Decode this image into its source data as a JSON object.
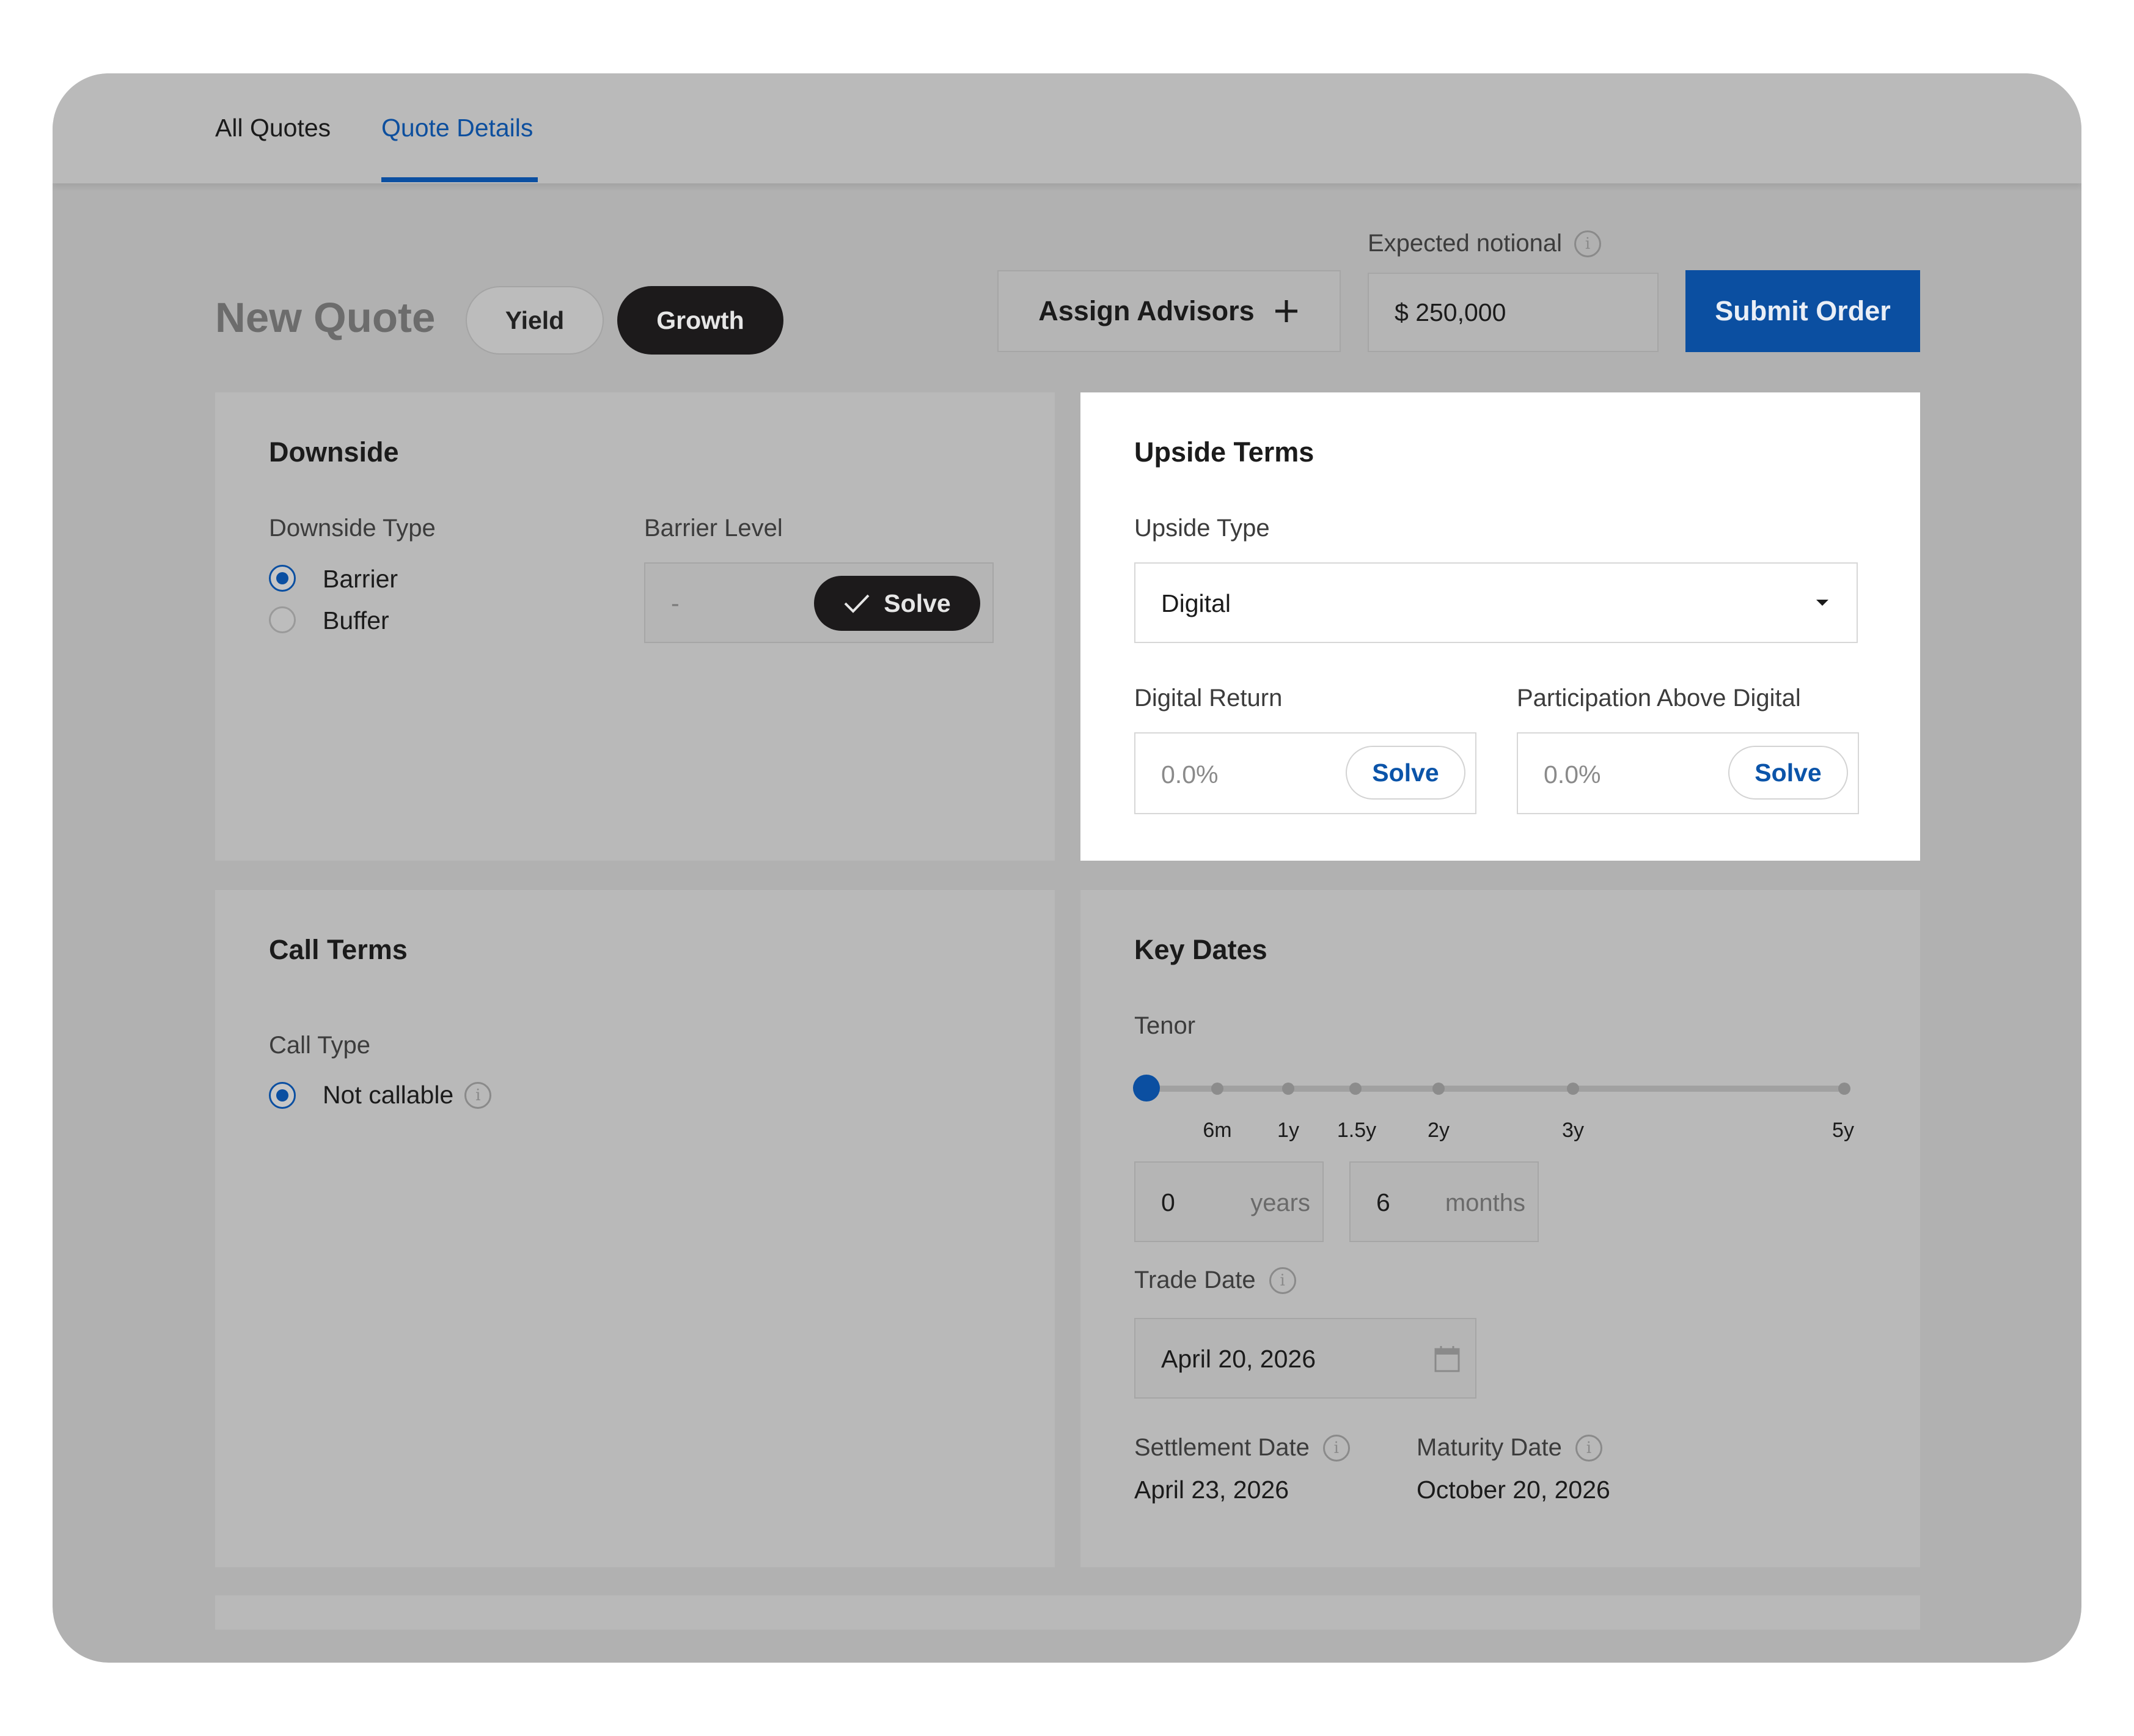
{
  "tabs": [
    {
      "label": "All Quotes"
    },
    {
      "label": "Quote Details"
    }
  ],
  "header": {
    "title": "New Quote",
    "toggle": [
      "Yield",
      "Growth"
    ],
    "assign_label": "Assign Advisors",
    "notional_label": "Expected notional",
    "notional_value": "$ 250,000",
    "submit_label": "Submit Order"
  },
  "downside": {
    "title": "Downside",
    "type_label": "Downside Type",
    "options": [
      "Barrier",
      "Buffer"
    ],
    "barrier_label": "Barrier Level",
    "barrier_value": "-",
    "solve_label": "Solve"
  },
  "upside": {
    "title": "Upside Terms",
    "type_label": "Upside Type",
    "type_value": "Digital",
    "digital_return_label": "Digital Return",
    "digital_return_value": "0.0%",
    "participation_label": "Participation Above Digital",
    "participation_value": "0.0%",
    "solve_label": "Solve"
  },
  "call": {
    "title": "Call Terms",
    "type_label": "Call Type",
    "option": "Not callable"
  },
  "dates": {
    "title": "Key Dates",
    "tenor_label": "Tenor",
    "tenor_ticks": [
      "6m",
      "1y",
      "1.5y",
      "2y",
      "3y",
      "5y"
    ],
    "years_value": "0",
    "years_unit": "years",
    "months_value": "6",
    "months_unit": "months",
    "trade_date_label": "Trade Date",
    "trade_date_value": "April 20, 2026",
    "settlement_label": "Settlement Date",
    "settlement_value": "April 23, 2026",
    "maturity_label": "Maturity Date",
    "maturity_value": "October 20, 2026"
  },
  "colors": {
    "accent": "#0b4fa1",
    "overlay": "#b1b1b1",
    "dark_pill": "#1c1a1b"
  }
}
